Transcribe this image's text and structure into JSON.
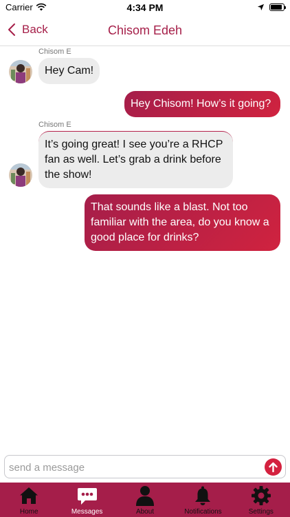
{
  "status_bar": {
    "carrier": "Carrier",
    "time": "4:34 PM"
  },
  "nav": {
    "back_label": "Back",
    "title": "Chisom Edeh"
  },
  "messages": [
    {
      "direction": "incoming",
      "sender": "Chisom E",
      "text": "Hey Cam!"
    },
    {
      "direction": "outgoing",
      "text": "Hey Chisom! How’s it going?"
    },
    {
      "direction": "incoming",
      "sender": "Chisom E",
      "text": "It’s going great! I see you’re a RHCP fan as well. Let’s grab a drink before the show!"
    },
    {
      "direction": "outgoing",
      "text": "That sounds like a blast. Not too familiar with the area, do you know a good place for drinks?"
    }
  ],
  "composer": {
    "placeholder": "send a message",
    "value": ""
  },
  "tabs": [
    {
      "label": "Home",
      "icon": "home-icon"
    },
    {
      "label": "Messages",
      "icon": "chat-bubble-icon",
      "active": true
    },
    {
      "label": "About",
      "icon": "person-icon"
    },
    {
      "label": "Notifications",
      "icon": "bell-icon"
    },
    {
      "label": "Settings",
      "icon": "gear-icon"
    }
  ],
  "colors": {
    "accent": "#a51e4a",
    "bubble_incoming": "#ececec",
    "bubble_outgoing": "#c6213f"
  }
}
